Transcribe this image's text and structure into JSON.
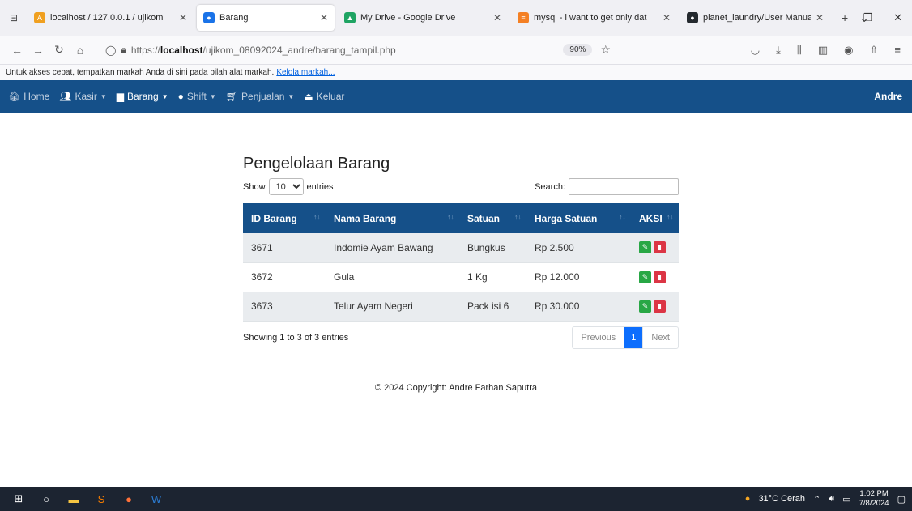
{
  "browser": {
    "tabs": [
      {
        "title": "localhost / 127.0.0.1 / ujikom",
        "active": false,
        "fav_color": "#f0a020",
        "fav_glyph": "A"
      },
      {
        "title": "Barang",
        "active": true,
        "fav_color": "#1a73e8",
        "fav_glyph": "●"
      },
      {
        "title": "My Drive - Google Drive",
        "active": false,
        "fav_color": "#1fa463",
        "fav_glyph": "▲"
      },
      {
        "title": "mysql - i want to get only dat",
        "active": false,
        "fav_color": "#f48024",
        "fav_glyph": "≡"
      },
      {
        "title": "planet_laundry/User Manual",
        "active": false,
        "fav_color": "#24292e",
        "fav_glyph": "●"
      }
    ],
    "url_prefix": "https://",
    "url_host": "localhost",
    "url_path": "/ujikom_08092024_andre/barang_tampil.php",
    "zoom": "90%",
    "bookmark_hint": "Untuk akses cepat, tempatkan markah Anda di sini pada bilah alat markah.",
    "bookmark_link": "Kelola markah..."
  },
  "nav": {
    "home": "Home",
    "kasir": "Kasir",
    "barang": "Barang",
    "shift": "Shift",
    "penjualan": "Penjualan",
    "keluar": "Keluar",
    "user": "Andre"
  },
  "page": {
    "title": "Pengelolaan Barang",
    "show_label": "Show",
    "entries_label": "entries",
    "length_value": "10",
    "search_label": "Search:",
    "search_value": ""
  },
  "table": {
    "columns": [
      "ID Barang",
      "Nama Barang",
      "Satuan",
      "Harga Satuan",
      "AKSI"
    ],
    "rows": [
      [
        "3671",
        "Indomie Ayam Bawang",
        "Bungkus",
        "Rp 2.500"
      ],
      [
        "3672",
        "Gula",
        "1 Kg",
        "Rp 12.000"
      ],
      [
        "3673",
        "Telur Ayam Negeri",
        "Pack isi 6",
        "Rp 30.000"
      ]
    ]
  },
  "pagination": {
    "info": "Showing 1 to 3 of 3 entries",
    "previous": "Previous",
    "current": "1",
    "next": "Next"
  },
  "footer": {
    "text": "© 2024 Copyright: Andre Farhan Saputra"
  },
  "taskbar": {
    "weather": "31°C  Cerah",
    "time": "1:02 PM",
    "date": "7/8/2024"
  },
  "colors": {
    "navbar": "#155089",
    "edit": "#28a745",
    "delete": "#dc3545",
    "page_active": "#0d6efd"
  }
}
